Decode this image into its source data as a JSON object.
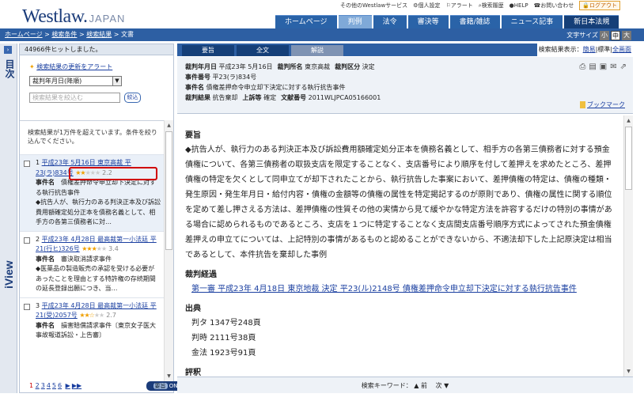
{
  "header": {
    "logo_main": "Westlaw.",
    "logo_sub": "JAPAN",
    "util_links": [
      "その他のWestlawサービス",
      "個人設定",
      "アラート",
      "検索履歴",
      "HELP",
      "お問い合わせ"
    ],
    "logout": "ログアウト",
    "nav_tabs": [
      "ホームページ",
      "判例",
      "法令",
      "審決等",
      "書籍/雑誌",
      "ニュース記事",
      "新日本法規"
    ]
  },
  "crumb": {
    "home": "ホームページ",
    "cond": "検索条件",
    "result": "検索結果",
    "doc": "文書",
    "sep": " > ",
    "fontsize_label": "文字サイズ",
    "sizes": [
      "小",
      "中",
      "大"
    ]
  },
  "left": {
    "side_label": "目次",
    "side_view": "iView",
    "hits": "44966件ヒットしました。",
    "alert": "検索結果の更新をアラート",
    "sort": "裁判年月日(降順)",
    "narrow_placeholder": "検索結果を絞込む",
    "narrow_btn": "絞込",
    "note": "検索結果が1万件を超えています。条件を絞り込んでください。",
    "items": [
      {
        "num": "1",
        "title": "平成23年 5月16日 東京高裁 平23(ラ)834号",
        "score": "2.2",
        "stars_on": "★★",
        "stars_off": "★★★",
        "case_label": "事件名",
        "case": "債権差押命令申立却下決定に対する執行抗告事件",
        "summary": "◆抗告人が、執行力のある判決正本及び訴訟費用額確定処分正本を債務名義として、相手方の各第三債務者に対…"
      },
      {
        "num": "2",
        "title": "平成23年 4月28日 最高裁第一小法廷 平21(行ヒ)326号",
        "score": "3.4",
        "stars_on": "★★★",
        "stars_off": "★★",
        "case_label": "事件名",
        "case": "審決取消請求事件",
        "summary": "◆医薬品の製造販売の承認を受ける必要があったことを理由とする特許権の存続期間の延長登録出願につき、当…"
      },
      {
        "num": "3",
        "title": "平成23年 4月28日 最高裁第一小法廷 平21(受)2057号",
        "score": "2.7",
        "stars_on": "★★☆",
        "stars_off": "★★",
        "case_label": "事件名",
        "case": "損害賠償請求事件〔東京女子医大事故報道訴訟・上告審〕",
        "summary": ""
      }
    ],
    "pager_current": "1",
    "pager": [
      "2",
      "3",
      "4",
      "5",
      "6"
    ],
    "pager_next": "▶",
    "pager_last": "▶▶",
    "toggle_label": "要旨",
    "toggle_state": "ON"
  },
  "right": {
    "tabs": [
      "要旨",
      "全文",
      "解説"
    ],
    "disp_label": "検索結果表示：",
    "disp_simple": "簡易",
    "disp_std": "標準",
    "disp_full": "全画面",
    "meta": {
      "date_label": "裁判年月日",
      "date": "平成23年 5月16日",
      "court_label": "裁判所名",
      "court": "東京高裁",
      "kind_label": "裁判区分",
      "kind": "決定",
      "no_label": "事件番号",
      "no": "平23(ラ)834号",
      "name_label": "事件名",
      "name": "債権差押命令申立却下決定に対する執行抗告事件",
      "result_label": "裁判結果",
      "result": "抗告棄却",
      "appeal_label": "上訴等",
      "appeal": "確定",
      "docno_label": "文献番号",
      "docno": "2011WLJPCA05166001"
    },
    "bookmark": "ブックマーク",
    "doc": {
      "summary_h": "要旨",
      "summary": "◆抗告人が、執行力のある判決正本及び訴訟費用額確定処分正本を債務名義として、相手方の各第三債務者に対する預金債権について、各第三債務者の取扱支店を限定することなく、支店番号により順序を付して差押えを求めたところ、差押債権の特定を欠くとして同申立てが却下されたことから、執行抗告した事案において、差押債権の特定は、債権の種類・発生原因・発生年月日・給付内容・債権の金額等の債権の属性を特定掲記するのが原則であり、債権の属性に関する順位を定めて差し押さえる方法は、差押債権の性質その他の実情から見て緩やかな特定方法を許容するだけの特別の事情がある場合に認められるものであるところ、支店を１つに特定することなく支店間支店番号順序方式によってされた預金債権差押えの申立てについては、上記特別の事情があるものと認めることができないから、不適法却下した上記原決定は相当であるとして、本件抗告を棄却した事例",
      "history_h": "裁判経過",
      "history": "第一審 平成23年 4月18日 東京地裁 決定 平23(ル)2148号 債権差押命令申立却下決定に対する執行抗告事件",
      "source_h": "出典",
      "sources": [
        "判タ 1347号248頁",
        "判時 2111号38頁",
        "金法 1923号91頁"
      ],
      "review_h": "評釈"
    },
    "kw_label": "検索キーワード：",
    "kw_prev": "▲ 前",
    "kw_next": "次 ▼"
  }
}
